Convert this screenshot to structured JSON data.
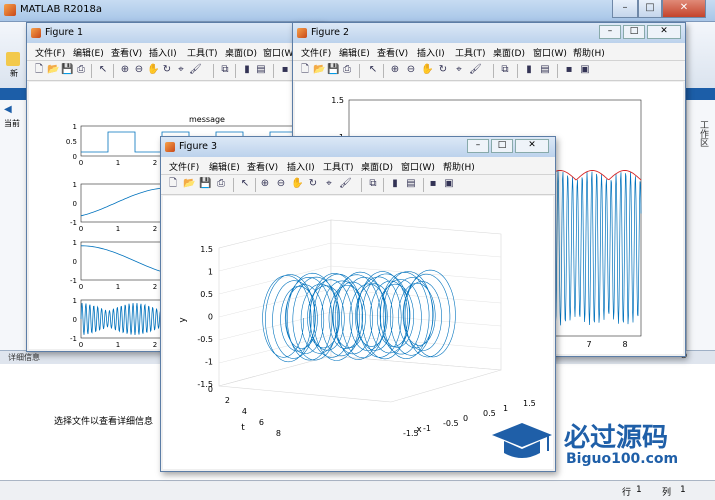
{
  "main_window": {
    "title": "MATLAB R2018a",
    "side_label": "工作区",
    "detail_label": "详细信息",
    "detail_message": "选择文件以查看详细信息",
    "status": {
      "row_label": "行",
      "row_value": "1",
      "col_label": "列",
      "col_value": "1"
    },
    "strip_labels": [
      "新",
      "当前"
    ]
  },
  "figures": [
    {
      "title": "Figure 1",
      "menu": [
        "文件(F)",
        "编辑(E)",
        "查看(V)",
        "插入(I)",
        "工具(T)",
        "桌面(D)",
        "窗口(W)"
      ]
    },
    {
      "title": "Figure 2",
      "menu": [
        "文件(F)",
        "编辑(E)",
        "查看(V)",
        "插入(I)",
        "工具(T)",
        "桌面(D)",
        "窗口(W)",
        "帮助(H)"
      ]
    },
    {
      "title": "Figure 3",
      "menu": [
        "文件(F)",
        "编辑(E)",
        "查看(V)",
        "插入(I)",
        "工具(T)",
        "桌面(D)",
        "窗口(W)",
        "帮助(H)"
      ]
    }
  ],
  "figure1": {
    "plot1_title": "message",
    "plot1_yticks": [
      "1",
      "0.5",
      "0"
    ],
    "plot2_yticks": [
      "1",
      "0",
      "-1"
    ],
    "plot3_yticks": [
      "1",
      "0",
      "-1"
    ],
    "plot4_yticks": [
      "1",
      "0",
      "-1"
    ],
    "xticks": [
      "0",
      "1",
      "2"
    ]
  },
  "figure2": {
    "yticks": [
      "1.5",
      "1"
    ],
    "xticks": [
      "6",
      "7",
      "8"
    ]
  },
  "figure3": {
    "zticks": [
      "1.5",
      "1",
      "0.5",
      "0",
      "-0.5",
      "-1",
      "-1.5"
    ],
    "t_ticks": [
      "0",
      "2",
      "4",
      "6",
      "8"
    ],
    "x_ticks": [
      "1.5",
      "1",
      "0.5",
      "0",
      "-0.5",
      "-1",
      "-1.5"
    ],
    "ylabel": "y",
    "tlabel": "t",
    "xlabel": "x"
  },
  "brand": {
    "name_cn": "必过源码",
    "domain": "Biguo100.com"
  },
  "colors": {
    "line": "#0072bd",
    "envelope": "#d62728",
    "brand": "#1f5fa8"
  }
}
